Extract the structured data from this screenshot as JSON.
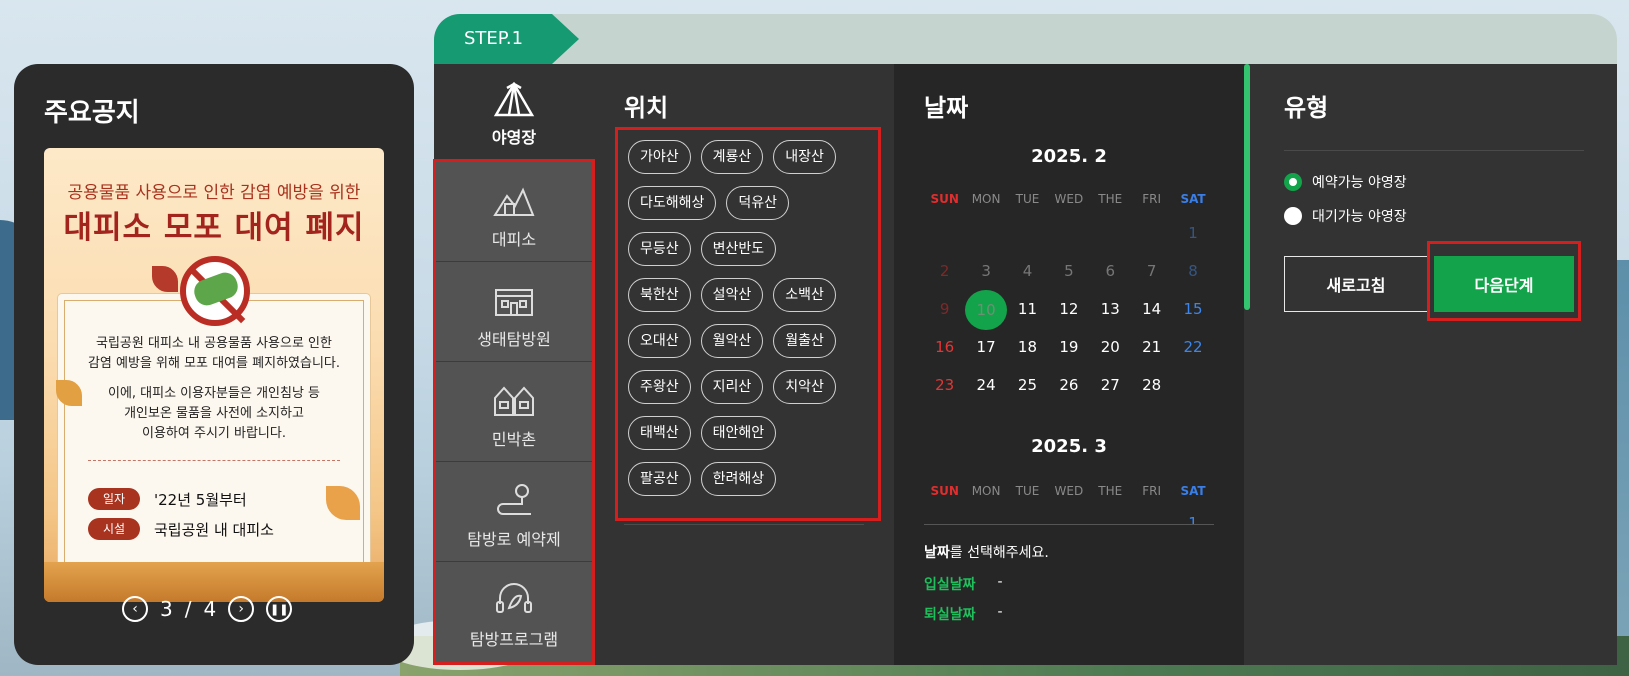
{
  "notice": {
    "title": "주요공지",
    "poster": {
      "subtitle": "공용물품 사용으로 인한 감염 예방을 위한",
      "headline": "대피소 모포 대여 폐지",
      "body1_line1": "국립공원 대피소 내 공용물품 사용으로 인한",
      "body1_line2": "감염 예방을 위해 모포 대여를 폐지하였습니다.",
      "body2_line1": "이에, 대피소 이용자분들은 개인침낭 등",
      "body2_line2": "개인보온 물품을 사전에 소지하고",
      "body2_line3": "이용하여 주시기 바랍니다.",
      "date_label": "일자",
      "date_value": "'22년 5월부터",
      "place_label": "시설",
      "place_value": "국립공원 내 대피소"
    },
    "pager": {
      "current": "3",
      "sep": "/",
      "total": "4"
    }
  },
  "step": {
    "label": "STEP.1"
  },
  "categories": {
    "active": {
      "label": "야영장",
      "icon": "tent-icon"
    },
    "items": [
      {
        "label": "대피소",
        "icon": "shelter-icon"
      },
      {
        "label": "생태탐방원",
        "icon": "eco-center-icon"
      },
      {
        "label": "민박촌",
        "icon": "village-icon"
      },
      {
        "label": "탐방로 예약제",
        "icon": "trail-icon"
      },
      {
        "label": "탐방프로그램",
        "icon": "program-icon"
      }
    ]
  },
  "location": {
    "title": "위치",
    "rows": [
      [
        "가야산",
        "계룡산",
        "내장산"
      ],
      [
        "다도해해상",
        "덕유산"
      ],
      [
        "무등산",
        "변산반도"
      ],
      [
        "북한산",
        "설악산",
        "소백산"
      ],
      [
        "오대산",
        "월악산",
        "월출산"
      ],
      [
        "주왕산",
        "지리산",
        "치악산"
      ],
      [
        "태백산",
        "태안해안"
      ],
      [
        "팔공산",
        "한려해상"
      ]
    ]
  },
  "date": {
    "title": "날짜",
    "dow": [
      "SUN",
      "MON",
      "TUE",
      "WED",
      "THE",
      "FRI",
      "SAT"
    ],
    "month1": {
      "label": "2025. 2",
      "weeks": [
        [
          "",
          "",
          "",
          "",
          "",
          "",
          "1"
        ],
        [
          "2",
          "3",
          "4",
          "5",
          "6",
          "7",
          "8"
        ],
        [
          "9",
          "10",
          "11",
          "12",
          "13",
          "14",
          "15"
        ],
        [
          "16",
          "17",
          "18",
          "19",
          "20",
          "21",
          "22"
        ],
        [
          "23",
          "24",
          "25",
          "26",
          "27",
          "28",
          ""
        ]
      ]
    },
    "month2": {
      "label": "2025. 3",
      "first_sat": "1"
    },
    "help_bold": "날짜",
    "help_rest": "를 선택해주세요.",
    "checkin_label": "입실날짜",
    "checkin_value": "-",
    "checkout_label": "퇴실날짜",
    "checkout_value": "-"
  },
  "type": {
    "title": "유형",
    "option1": "예약가능 야영장",
    "option2": "대기가능 야영장",
    "refresh": "새로고침",
    "next": "다음단계"
  },
  "colors": {
    "accent": "#13a34a",
    "step": "#159a72",
    "highlight": "#d51f1f",
    "sunday": "#e02d2d",
    "saturday": "#3a7ee6"
  }
}
